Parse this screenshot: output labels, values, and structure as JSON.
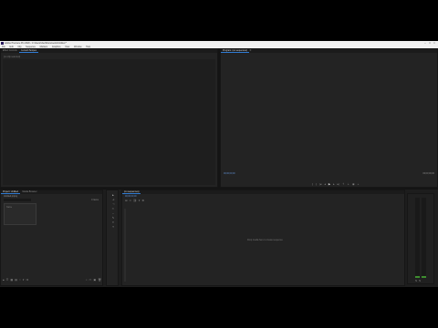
{
  "window": {
    "title": "Adobe Premiere Pro 2020 - C:\\Users\\User\\Documents\\Untitled *"
  },
  "menu": [
    "File",
    "Edit",
    "Clip",
    "Sequence",
    "Markers",
    "Graphics",
    "View",
    "Window",
    "Help"
  ],
  "source_panel": {
    "tabs": [
      "Effect Controls",
      "Lumetri Scopes"
    ],
    "active_tab": 1,
    "subtext": "(no clip selected)"
  },
  "program_monitor": {
    "title": "Program: (no sequences)",
    "left_timecode": "00;00;00;00",
    "right_timecode": "00;00;00;00"
  },
  "project_panel": {
    "tabs": [
      "Project: Untitled",
      "Media Browser"
    ],
    "filename": "Untitled.prproj",
    "item_count": "0 Items",
    "column_label": "Name"
  },
  "timeline": {
    "title": "(no sequences)",
    "timecode": "00;00;00;00",
    "drop_hint": "Drop media here to create sequence."
  },
  "audio_meter": {
    "levels": [
      0.02,
      0.02
    ],
    "accent": "#3e8d2f"
  },
  "colors": {
    "background": "#1d1d1d",
    "panel": "#232323",
    "accent": "#2f7bd3"
  }
}
